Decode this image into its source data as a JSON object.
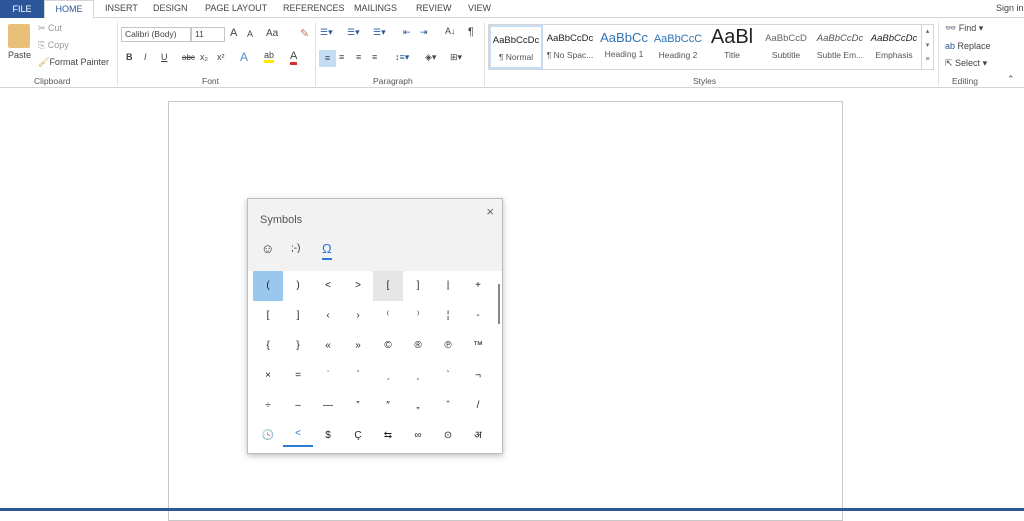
{
  "tabs": {
    "file": "FILE",
    "items": [
      "HOME",
      "INSERT",
      "DESIGN",
      "PAGE LAYOUT",
      "REFERENCES",
      "MAILINGS",
      "REVIEW",
      "VIEW"
    ],
    "sign_in": "Sign in"
  },
  "clipboard": {
    "paste": "Paste",
    "cut": "Cut",
    "copy": "Copy",
    "format_painter": "Format Painter",
    "label": "Clipboard"
  },
  "font": {
    "name": "Calibri (Body)",
    "size": "11",
    "label": "Font",
    "grow": "A",
    "shrink": "A",
    "case": "Aa",
    "bold": "B",
    "italic": "I",
    "underline": "U",
    "strike": "abc",
    "sub": "x₂",
    "sup": "x²"
  },
  "paragraph": {
    "label": "Paragraph",
    "pilcrow": "¶"
  },
  "styles": {
    "label": "Styles",
    "items": [
      {
        "preview": "AaBbCcDc",
        "name": "¶ Normal"
      },
      {
        "preview": "AaBbCcDc",
        "name": "¶ No Spac..."
      },
      {
        "preview": "AaBbCc",
        "name": "Heading 1"
      },
      {
        "preview": "AaBbCcC",
        "name": "Heading 2"
      },
      {
        "preview": "AaBl",
        "name": "Title"
      },
      {
        "preview": "AaBbCcD",
        "name": "Subtitle"
      },
      {
        "preview": "AaBbCcDc",
        "name": "Subtle Em..."
      },
      {
        "preview": "AaBbCcDc",
        "name": "Emphasis"
      }
    ]
  },
  "editing": {
    "label": "Editing",
    "find": "Find",
    "replace": "Replace",
    "select": "Select"
  },
  "symbols": {
    "title": "Symbols",
    "close": "×",
    "tabs": [
      "☺",
      ";-)",
      "Ω"
    ],
    "grid": [
      [
        "(",
        ")",
        "<",
        ">",
        "[",
        "]",
        "|",
        "+"
      ],
      [
        "[",
        "]",
        "‹",
        "›",
        "⁽",
        "⁾",
        "¦",
        "-"
      ],
      [
        "{",
        "}",
        "«",
        "»",
        "©",
        "®",
        "℗",
        "™"
      ],
      [
        "×",
        "=",
        "ˈ",
        "ˊ",
        "ˏ",
        "ˎ",
        "ˋ",
        "¬"
      ],
      [
        "÷",
        "–",
        "—",
        "‟",
        "″",
        "„",
        "‶",
        "/"
      ],
      [
        "🕓",
        "<",
        "$",
        "Ç",
        "⇆",
        "∞",
        "⊙",
        "अ"
      ]
    ]
  },
  "colors": {
    "accent": "#2b579a",
    "selected_cell": "#9ac7ee",
    "hover_cell": "#e6e6e6"
  }
}
